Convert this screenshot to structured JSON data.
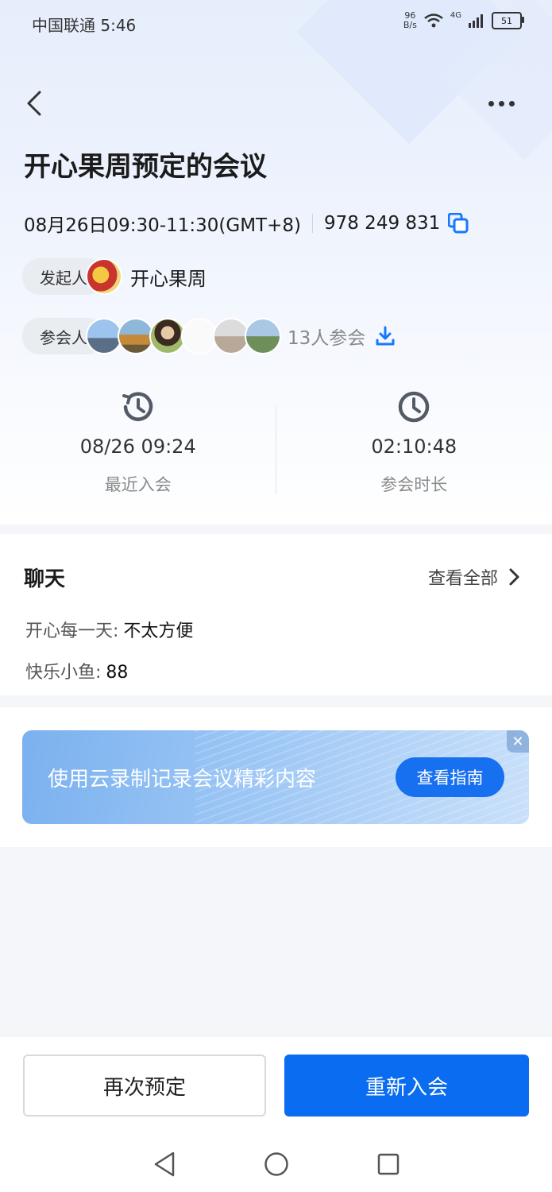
{
  "status_bar": {
    "carrier": "中国联通",
    "time": "5:46",
    "net_speed": "96",
    "net_speed_unit": "B/s",
    "network": "4G",
    "battery": "51"
  },
  "header": {
    "back_icon": "chevron-left-icon",
    "more_icon": "more-dots-icon"
  },
  "meeting": {
    "title": "开心果周预定的会议",
    "time": "08月26日09:30-11:30(GMT+8)",
    "meeting_id": "978 249 831"
  },
  "initiator": {
    "label": "发起人",
    "name": "开心果周"
  },
  "participants": {
    "label": "参会人",
    "count_text": "13人参会",
    "avatar_count": 6
  },
  "stats": {
    "recent_join": {
      "value": "08/26 09:24",
      "label": "最近入会",
      "icon": "history-clock-icon"
    },
    "duration": {
      "value": "02:10:48",
      "label": "参会时长",
      "icon": "clock-icon"
    }
  },
  "chat": {
    "title": "聊天",
    "view_all": "查看全部",
    "messages": [
      {
        "sender": "开心每一天:",
        "text": "不太方便"
      },
      {
        "sender": "快乐小鱼:",
        "text": "88"
      }
    ]
  },
  "banner": {
    "text": "使用云录制记录会议精彩内容",
    "button": "查看指南"
  },
  "actions": {
    "book_again": "再次预定",
    "rejoin": "重新入会"
  },
  "colors": {
    "primary": "#0a6cf0",
    "accent_icon": "#1677ff"
  }
}
